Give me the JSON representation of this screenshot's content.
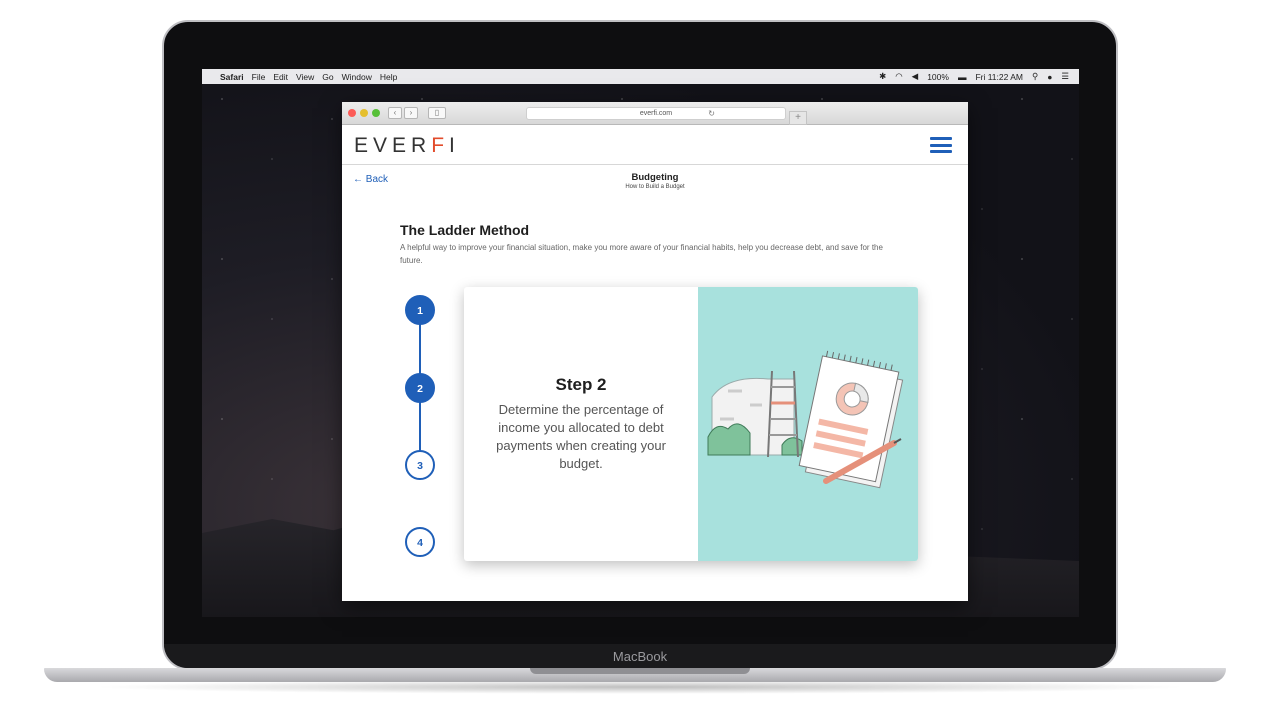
{
  "menubar": {
    "items": [
      "Safari",
      "File",
      "Edit",
      "View",
      "Go",
      "Window",
      "Help"
    ],
    "battery": "100%",
    "clock": "Fri 11:22 AM"
  },
  "browser": {
    "url": "everfi.com"
  },
  "app": {
    "logo": "EVERFI",
    "back_label": "← Back",
    "section_title": "Budgeting",
    "section_subtitle": "How to Build a Budget"
  },
  "lesson": {
    "title": "The Ladder Method",
    "description": "A helpful way to improve your financial situation, make you more aware of your financial habits, help you decrease debt, and save for the future.",
    "steps": [
      {
        "label": "1"
      },
      {
        "label": "2"
      },
      {
        "label": "3"
      },
      {
        "label": "4"
      }
    ],
    "current_step": 2,
    "card": {
      "heading": "Step 2",
      "body": "Determine the percentage of income you allocated to debt payments when creating your budget."
    }
  },
  "device": {
    "label": "MacBook"
  },
  "colors": {
    "accent": "#1f5fb8",
    "art_background": "#a8e1dd",
    "logo_accent": "#e24c2c"
  }
}
